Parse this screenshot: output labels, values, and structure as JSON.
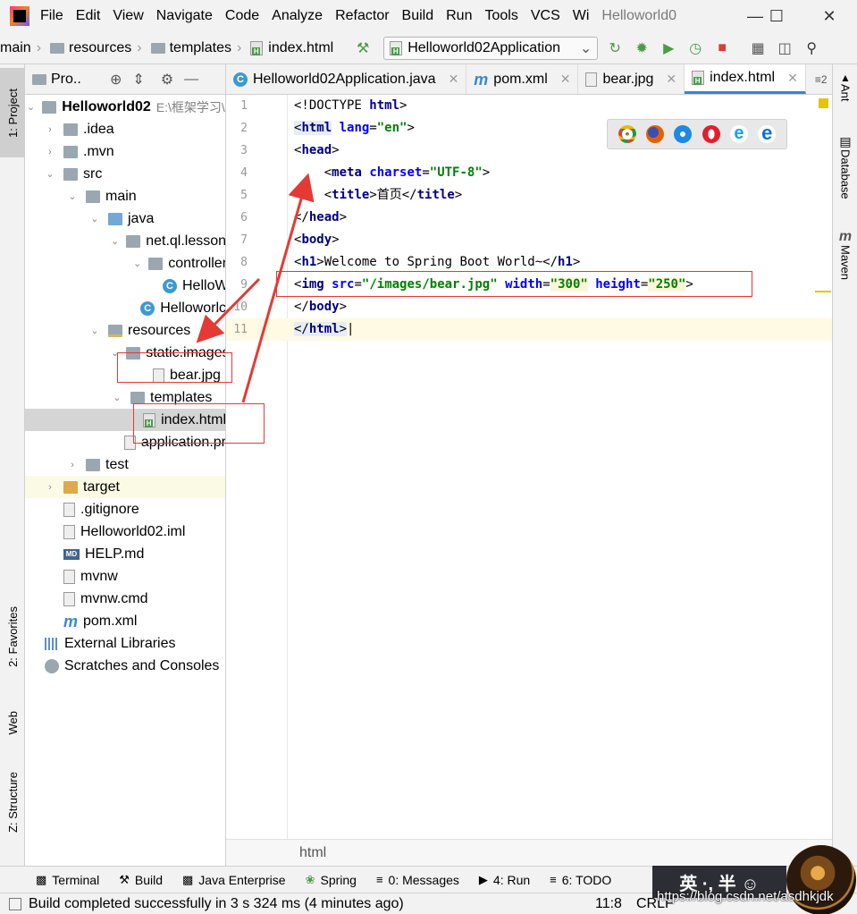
{
  "menu": {
    "items": [
      "File",
      "Edit",
      "View",
      "Navigate",
      "Code",
      "Analyze",
      "Refactor",
      "Build",
      "Run",
      "Tools",
      "VCS",
      "Wi"
    ],
    "window_title": "Helloworld0"
  },
  "navbar": {
    "crumbs": [
      "main",
      "resources",
      "templates",
      "index.html"
    ],
    "run_config": "Helloworld02Application"
  },
  "left_tabs": {
    "project": "1: Project",
    "favorites": "2: Favorites",
    "web": "Web",
    "structure": "Z: Structure"
  },
  "project_panel": {
    "header": "Pro..",
    "tree": [
      {
        "label": "Helloworld02",
        "suffix": "E:\\框架学习\\H",
        "depth": 0,
        "chevron": "down",
        "icon": "folder"
      },
      {
        "label": ".idea",
        "depth": 1,
        "chevron": "right",
        "icon": "folder"
      },
      {
        "label": ".mvn",
        "depth": 1,
        "chevron": "right",
        "icon": "folder"
      },
      {
        "label": "src",
        "depth": 1,
        "chevron": "down",
        "icon": "folder"
      },
      {
        "label": "main",
        "depth": 2,
        "chevron": "down",
        "icon": "folder"
      },
      {
        "label": "java",
        "depth": 3,
        "chevron": "down",
        "icon": "folder-blue"
      },
      {
        "label": "net.ql.lesson0",
        "depth": 4,
        "chevron": "down",
        "icon": "pkg"
      },
      {
        "label": "controller",
        "depth": 5,
        "chevron": "down",
        "icon": "pkg"
      },
      {
        "label": "HelloW",
        "depth": 6,
        "chevron": "",
        "icon": "class"
      },
      {
        "label": "Helloworlc",
        "depth": 5,
        "chevron": "",
        "icon": "class"
      },
      {
        "label": "resources",
        "depth": 3,
        "chevron": "down",
        "icon": "folder-res"
      },
      {
        "label": "static.images",
        "depth": 4,
        "chevron": "down",
        "icon": "folder"
      },
      {
        "label": "bear.jpg",
        "depth": 5,
        "chevron": "",
        "icon": "file"
      },
      {
        "label": "templates",
        "depth": 4,
        "chevron": "down",
        "icon": "folder"
      },
      {
        "label": "index.html",
        "depth": 5,
        "chevron": "",
        "icon": "html",
        "selected": true
      },
      {
        "label": "application.pr",
        "depth": 4,
        "chevron": "",
        "icon": "file"
      },
      {
        "label": "test",
        "depth": 2,
        "chevron": "right",
        "icon": "folder"
      },
      {
        "label": "target",
        "depth": 1,
        "chevron": "right",
        "icon": "folder-orange",
        "highlight": true
      },
      {
        "label": ".gitignore",
        "depth": 1,
        "chevron": "",
        "icon": "file"
      },
      {
        "label": "Helloworld02.iml",
        "depth": 1,
        "chevron": "",
        "icon": "file"
      },
      {
        "label": "HELP.md",
        "depth": 1,
        "chevron": "",
        "icon": "md"
      },
      {
        "label": "mvnw",
        "depth": 1,
        "chevron": "",
        "icon": "file"
      },
      {
        "label": "mvnw.cmd",
        "depth": 1,
        "chevron": "",
        "icon": "file"
      },
      {
        "label": "pom.xml",
        "depth": 1,
        "chevron": "",
        "icon": "m"
      },
      {
        "label": "External Libraries",
        "depth": 0,
        "chevron": "",
        "icon": "lib"
      },
      {
        "label": "Scratches and Consoles",
        "depth": 0,
        "chevron": "",
        "icon": "scratch"
      }
    ]
  },
  "editor": {
    "tabs": [
      {
        "label": "Helloworld02Application.java",
        "icon": "class",
        "active": false
      },
      {
        "label": "pom.xml",
        "icon": "m",
        "active": false
      },
      {
        "label": "bear.jpg",
        "icon": "file",
        "active": false
      },
      {
        "label": "index.html",
        "icon": "html",
        "active": true
      }
    ],
    "tab_overflow": "≡2",
    "line_numbers": [
      "1",
      "2",
      "3",
      "4",
      "5",
      "6",
      "7",
      "8",
      "9",
      "10",
      "11"
    ],
    "bottom_breadcrumb": "html"
  },
  "right_tabs": {
    "ant": "Ant",
    "database": "Database",
    "maven": "Maven"
  },
  "bottom_tools": [
    {
      "label": "Terminal",
      "icon": "terminal-icon"
    },
    {
      "label": "Build",
      "icon": "hammer-icon"
    },
    {
      "label": "Java Enterprise",
      "icon": "java-enterprise-icon"
    },
    {
      "label": "Spring",
      "icon": "spring-icon"
    },
    {
      "label": "0: Messages",
      "icon": "messages-icon"
    },
    {
      "label": "4: Run",
      "icon": "run-icon"
    },
    {
      "label": "6: TODO",
      "icon": "todo-icon"
    }
  ],
  "status": {
    "message": "Build completed successfully in 3 s 324 ms (4 minutes ago)",
    "position": "11:8",
    "line_sep": "CRLF"
  },
  "overlay": {
    "ime_text": "英 ·, 半 ☺",
    "watermark": "https://blog.csdn.net/asdhkjdk"
  },
  "colors": {
    "tag": "#000080",
    "attr": "#0000ff",
    "value": "#008000",
    "annotation": "#e53935",
    "accent": "#4083c9"
  }
}
